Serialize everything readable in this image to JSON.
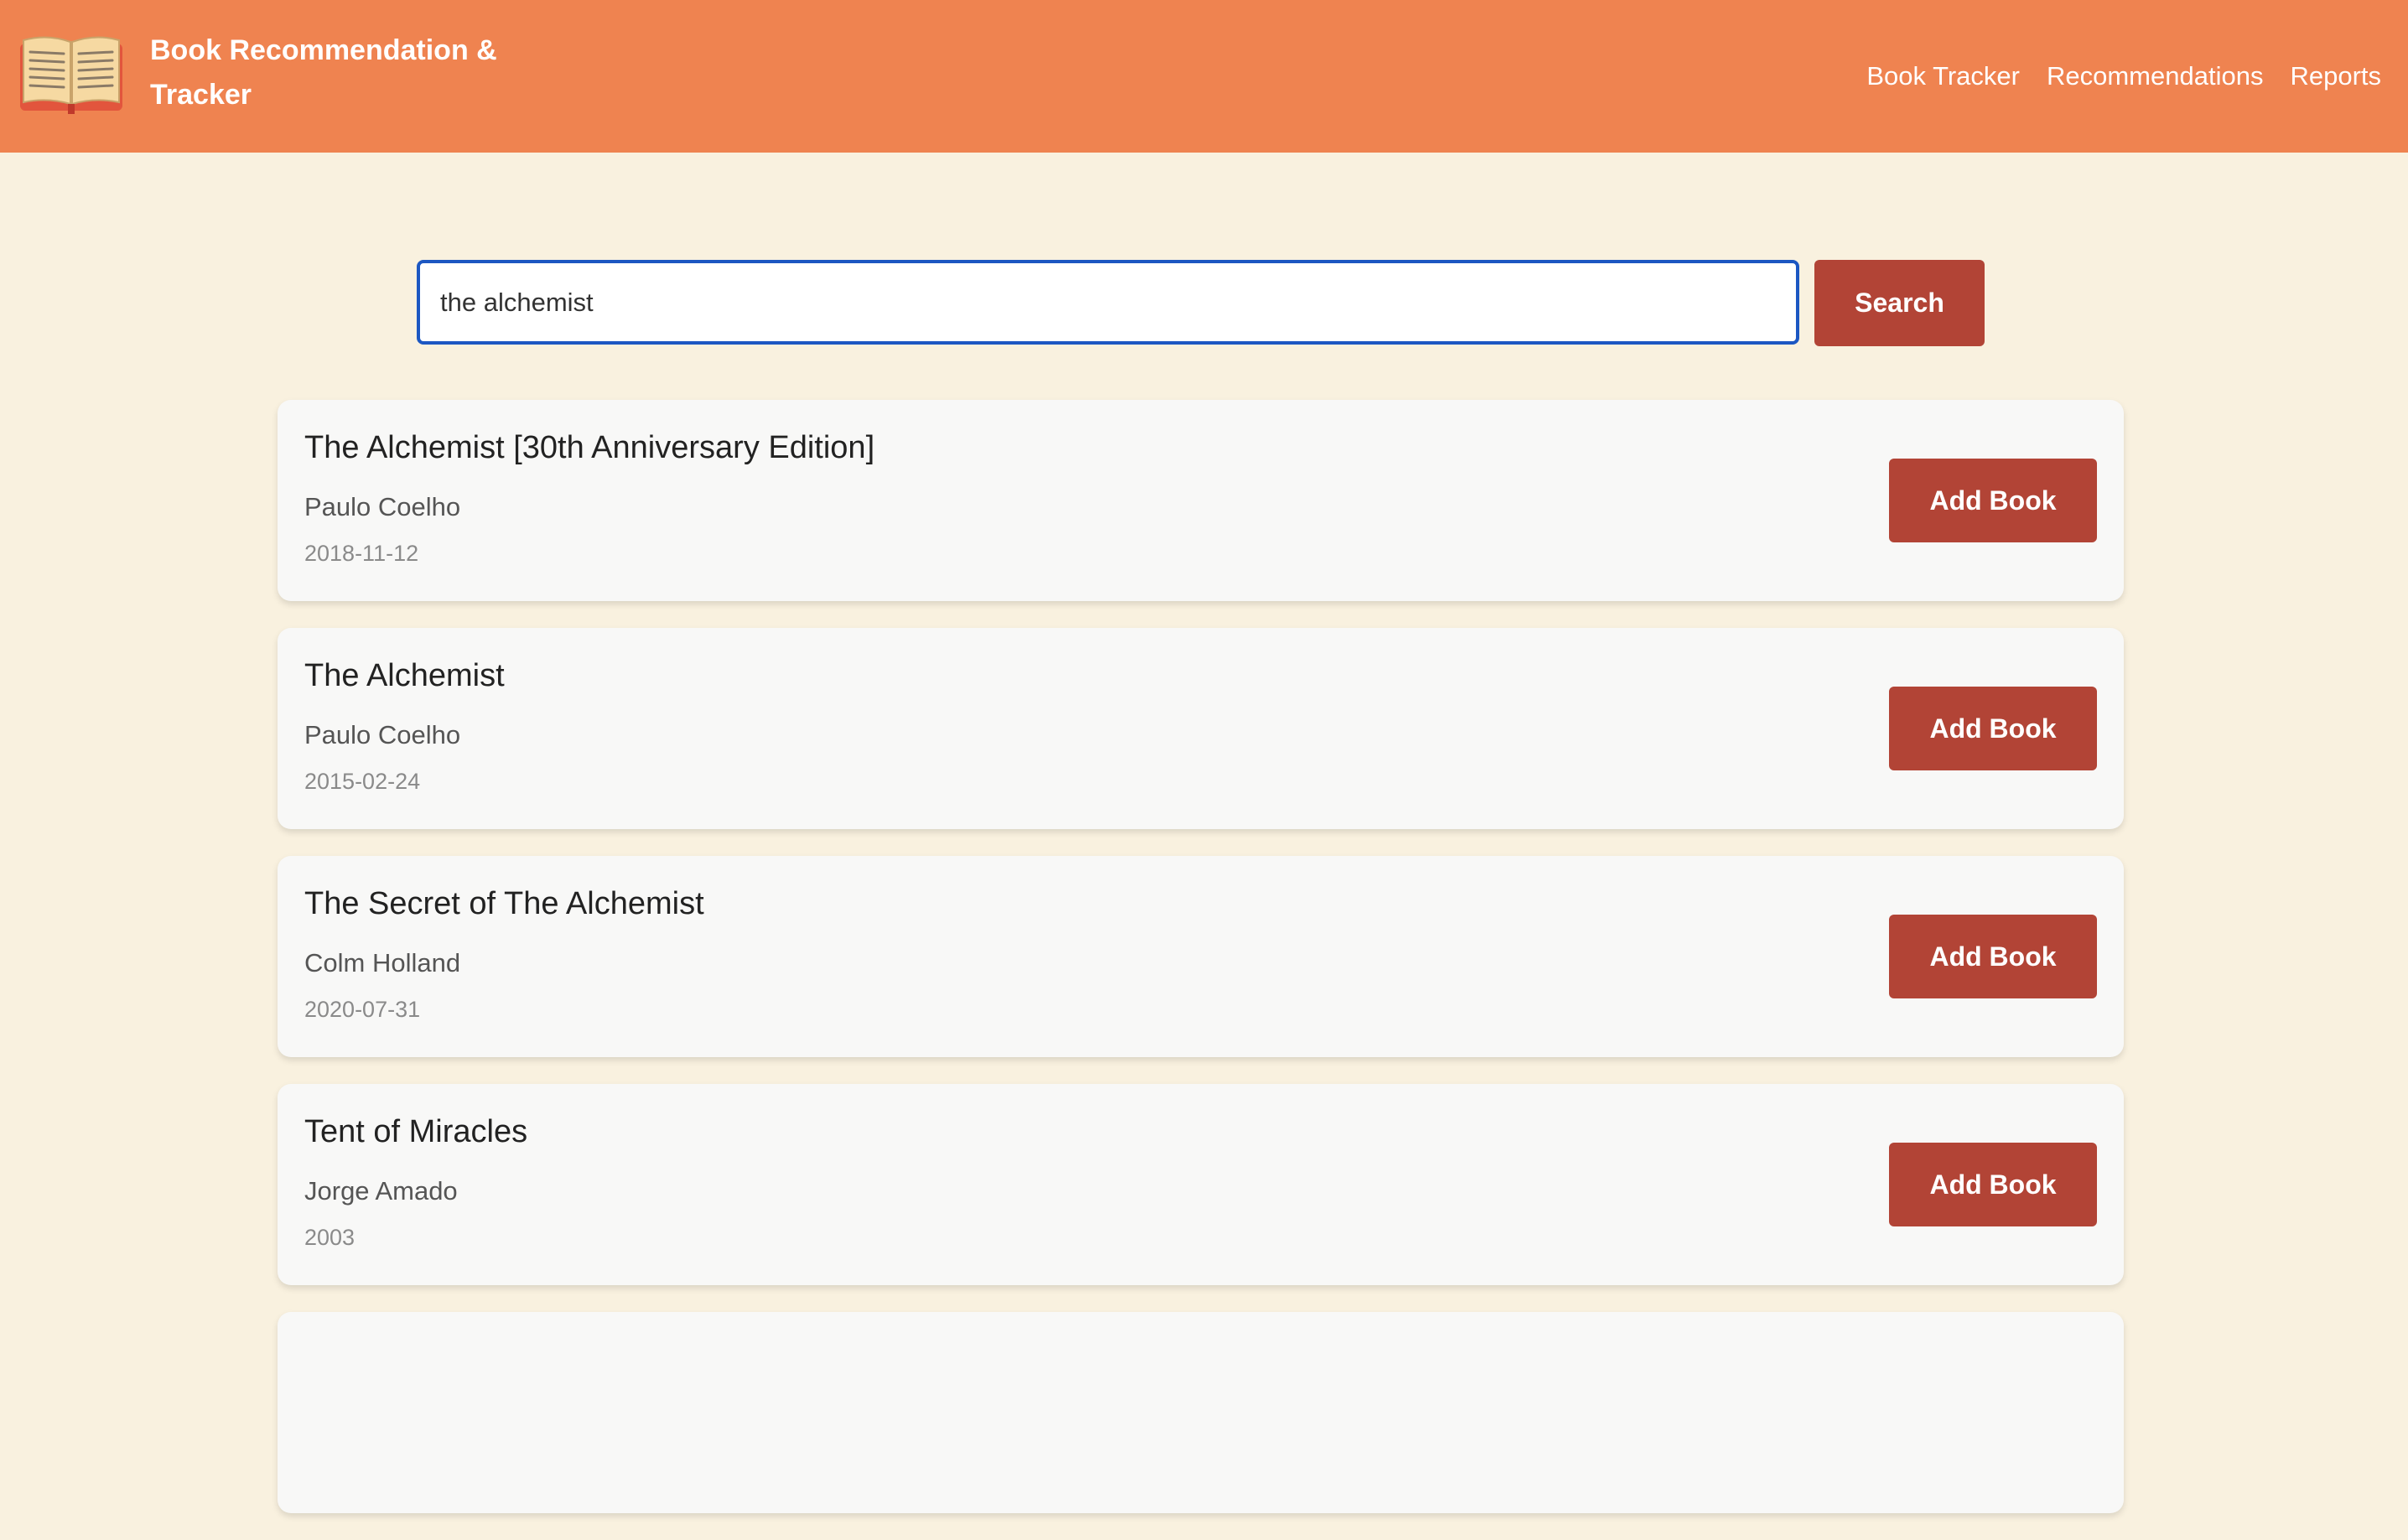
{
  "header": {
    "logo_icon": "open-book-icon",
    "title": "Book Recommendation & Tracker",
    "nav": [
      {
        "label": "Book Tracker"
      },
      {
        "label": "Recommendations"
      },
      {
        "label": "Reports"
      }
    ]
  },
  "search": {
    "value": "the alchemist",
    "button_label": "Search"
  },
  "results": [
    {
      "title": "The Alchemist [30th Anniversary Edition]",
      "author": "Paulo Coelho",
      "date": "2018-11-12",
      "button_label": "Add Book"
    },
    {
      "title": "The Alchemist",
      "author": "Paulo Coelho",
      "date": "2015-02-24",
      "button_label": "Add Book"
    },
    {
      "title": "The Secret of The Alchemist",
      "author": "Colm Holland",
      "date": "2020-07-31",
      "button_label": "Add Book"
    },
    {
      "title": "Tent of Miracles",
      "author": "Jorge Amado",
      "date": "2003",
      "button_label": "Add Book"
    }
  ],
  "colors": {
    "header_bg": "#ef8350",
    "page_bg": "#f9f1df",
    "button_bg": "#b24436",
    "input_border": "#1c57c2"
  }
}
